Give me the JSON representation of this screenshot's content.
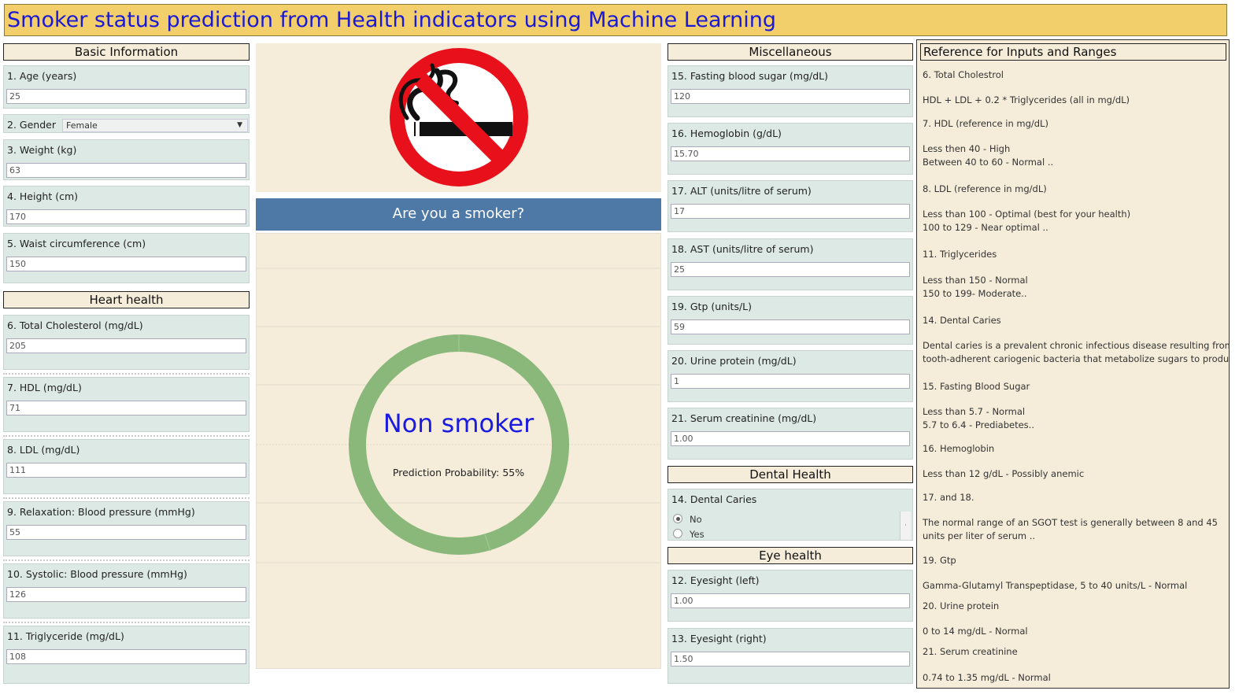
{
  "title": "Smoker status prediction from Health indicators using Machine Learning",
  "sections": {
    "basic": "Basic Information",
    "heart": "Heart health",
    "misc": "Miscellaneous",
    "dental": "Dental Health",
    "eye": "Eye health",
    "reference": "Reference for Inputs and Ranges"
  },
  "inputs": {
    "age": {
      "label": "1. Age (years)",
      "value": "25"
    },
    "gender": {
      "label": "2. Gender",
      "value": "Female"
    },
    "weight": {
      "label": "3. Weight (kg)",
      "value": "63"
    },
    "height": {
      "label": "4. Height (cm)",
      "value": "170"
    },
    "waist": {
      "label": "5. Waist circumference (cm)",
      "value": "150"
    },
    "cholesterol": {
      "label": "6. Total Cholesterol (mg/dL)",
      "value": "205"
    },
    "hdl": {
      "label": "7. HDL (mg/dL)",
      "value": "71"
    },
    "ldl": {
      "label": "8. LDL (mg/dL)",
      "value": "111"
    },
    "relaxation": {
      "label": "9. Relaxation: Blood pressure (mmHg)",
      "value": "55"
    },
    "systolic": {
      "label": "10. Systolic: Blood pressure (mmHg)",
      "value": "126"
    },
    "triglyceride": {
      "label": "11. Triglyceride (mg/dL)",
      "value": "108"
    },
    "fasting": {
      "label": "15. Fasting blood sugar (mg/dL)",
      "value": "120"
    },
    "hemoglobin": {
      "label": "16. Hemoglobin (g/dL)",
      "value": "15.70"
    },
    "alt": {
      "label": "17. ALT (units/litre of serum)",
      "value": "17"
    },
    "ast": {
      "label": "18. AST (units/litre of serum)",
      "value": "25"
    },
    "gtp": {
      "label": "19. Gtp (units/L)",
      "value": "59"
    },
    "urine": {
      "label": "20. Urine protein (mg/dL)",
      "value": "1"
    },
    "creatinine": {
      "label": "21. Serum creatinine (mg/dL)",
      "value": "1.00"
    },
    "dental_caries": {
      "label": "14. Dental Caries",
      "options": [
        "No",
        "Yes"
      ],
      "selected": "No"
    },
    "eye_left": {
      "label": "12. Eyesight (left)",
      "value": "1.00"
    },
    "eye_right": {
      "label": "13. Eyesight (right)",
      "value": "1.50"
    }
  },
  "prediction": {
    "question": "Are you a smoker?",
    "result": "Non smoker",
    "probability_text": "Prediction Probability: 55%",
    "ring_color": "#8ab87a"
  },
  "reference_lines": [
    "6. Total Cholestrol",
    "HDL + LDL + 0.2 * Triglycerides (all in mg/dL)",
    "7. HDL (reference in mg/dL)",
    "Less then 40 - High",
    "Between 40 to 60 - Normal  ..",
    "8. LDL (reference in mg/dL)",
    "Less than 100 - Optimal (best for your health)",
    "100 to 129  - Near optimal  ..",
    "11. Triglycerides",
    "Less than 150 - Normal",
    "150 to 199- Moderate..",
    "14. Dental Caries",
    "Dental caries is a prevalent chronic infectious disease resulting from",
    "tooth-adherent cariogenic bacteria that metabolize sugars to produ..",
    "15. Fasting Blood Sugar",
    "Less than 5.7 - Normal",
    "5.7 to 6.4 - Prediabetes..",
    "16. Hemoglobin",
    "Less than 12 g/dL - Possibly anemic",
    "17. and 18.",
    "The normal range of an SGOT test is generally between 8 and 45",
    "units per liter of serum  ..",
    "19. Gtp",
    "Gamma-Glutamyl Transpeptidase, 5 to 40 units/L - Normal",
    "20. Urine protein",
    "0 to 14 mg/dL - Normal",
    "21. Serum creatinine",
    "0.74 to 1.35 mg/dL - Normal"
  ]
}
